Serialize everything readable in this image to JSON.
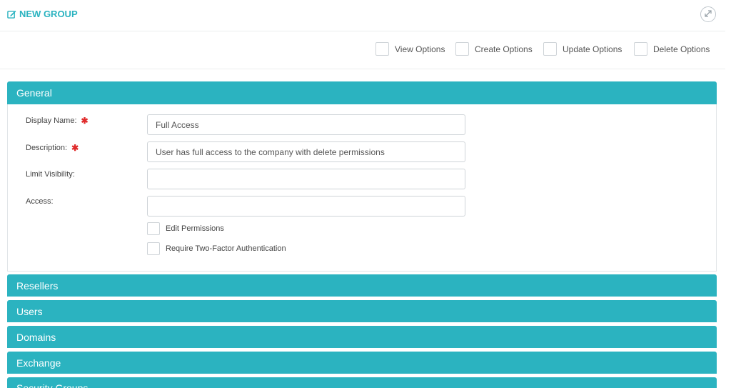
{
  "header": {
    "title": "NEW GROUP",
    "title_icon": "edit-icon",
    "expand_icon": "expand-icon"
  },
  "options": [
    {
      "label": "View Options",
      "checked": false
    },
    {
      "label": "Create Options",
      "checked": false
    },
    {
      "label": "Update Options",
      "checked": false
    },
    {
      "label": "Delete Options",
      "checked": false
    }
  ],
  "general": {
    "heading": "General",
    "fields": {
      "display_name": {
        "label": "Display Name:",
        "value": "Full Access",
        "required": true
      },
      "description": {
        "label": "Description:",
        "value": "User has full access to the company with delete permissions",
        "required": true
      },
      "limit_visibility": {
        "label": "Limit Visibility:",
        "value": ""
      },
      "access": {
        "label": "Access:",
        "value": ""
      }
    },
    "checkboxes": [
      {
        "label": "Edit Permissions",
        "checked": false
      },
      {
        "label": "Require Two-Factor Authentication",
        "checked": false
      }
    ]
  },
  "panels": [
    "Resellers",
    "Users",
    "Domains",
    "Exchange",
    "Security Groups"
  ],
  "colors": {
    "accent": "#2bb3c0",
    "required": "#e02b2b"
  }
}
